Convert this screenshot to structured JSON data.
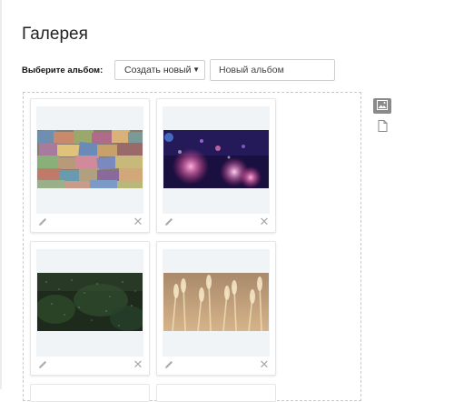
{
  "page": {
    "title": "Галерея"
  },
  "album": {
    "label": "Выберите альбом:",
    "select_value": "Создать новый",
    "input_placeholder": "Новый альбом"
  },
  "gallery": {
    "items": [
      {
        "photo": "banknotes-photo"
      },
      {
        "photo": "bokeh-lights-photo"
      },
      {
        "photo": "rainy-window-photo"
      },
      {
        "photo": "wheat-field-photo"
      }
    ]
  },
  "view_modes": [
    "grid-view-icon",
    "list-view-icon"
  ],
  "colors": {
    "active_view": "#8a8a8a",
    "thumb_bg": "#f1f4f6",
    "border": "#c8c8c8"
  }
}
